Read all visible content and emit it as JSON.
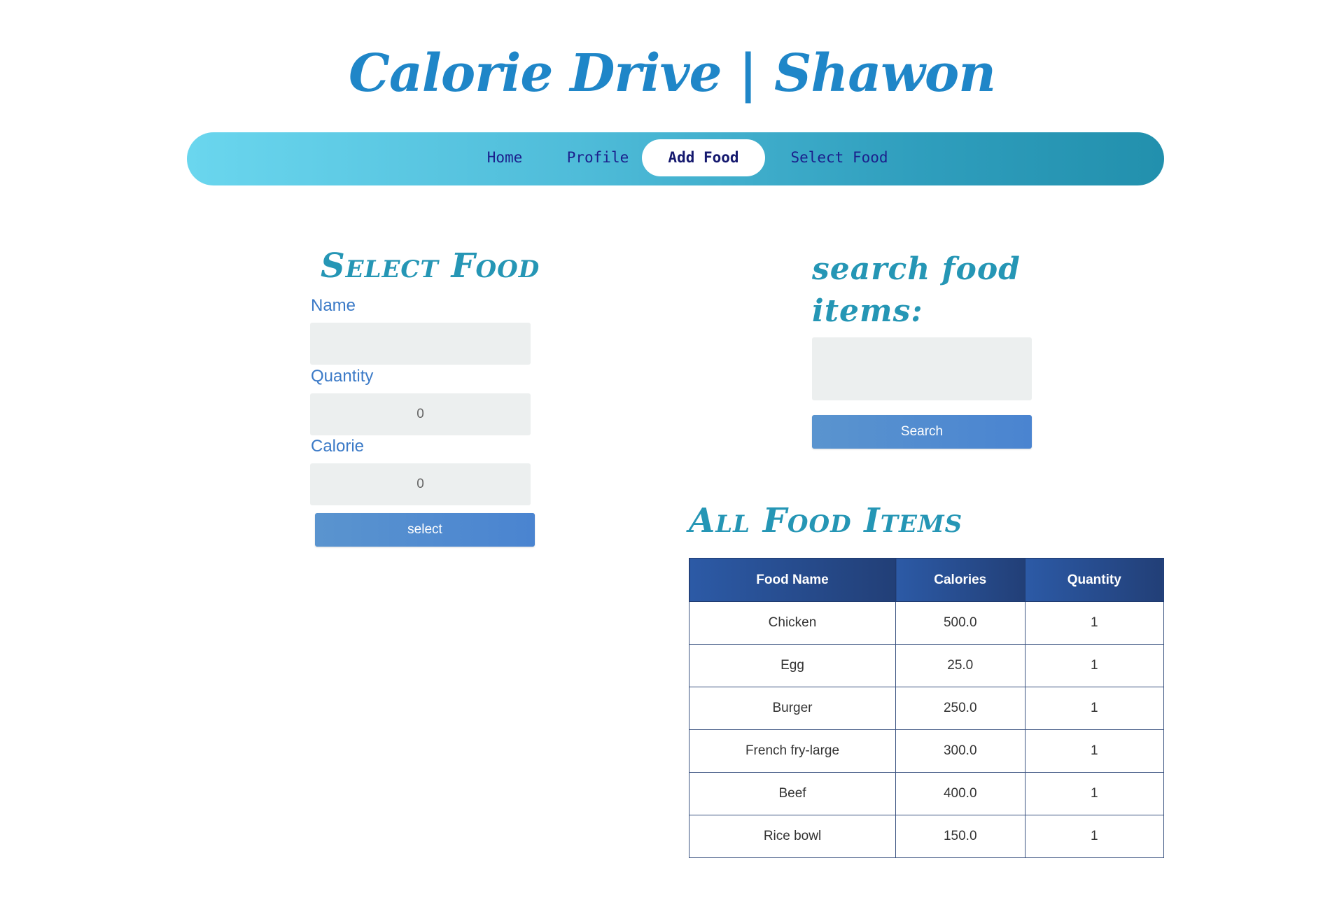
{
  "site": {
    "title": "Calorie Drive | Shawon"
  },
  "nav": {
    "items": [
      {
        "label": "Home",
        "active": false
      },
      {
        "label": "Profile",
        "active": false
      },
      {
        "label": "Add Food",
        "active": true
      },
      {
        "label": "Select Food",
        "active": false
      }
    ]
  },
  "select_food": {
    "heading": "Select Food",
    "name_label": "Name",
    "name_value": "",
    "quantity_label": "Quantity",
    "quantity_placeholder": "0",
    "calorie_label": "Calorie",
    "calorie_placeholder": "0",
    "select_button": "select"
  },
  "search": {
    "heading_line1": "search food",
    "heading_line2": "items:",
    "value": "",
    "button": "Search"
  },
  "all_food": {
    "heading": "All Food Items",
    "columns": [
      "Food Name",
      "Calories",
      "Quantity"
    ],
    "rows": [
      [
        "Chicken",
        "500.0",
        "1"
      ],
      [
        "Egg",
        "25.0",
        "1"
      ],
      [
        "Burger",
        "250.0",
        "1"
      ],
      [
        "French fry-large",
        "300.0",
        "1"
      ],
      [
        "Beef",
        "400.0",
        "1"
      ],
      [
        "Rice bowl",
        "150.0",
        "1"
      ]
    ]
  },
  "colors": {
    "title": "#1f86c8",
    "heading": "#2596b5",
    "label": "#3b7ac7",
    "nav_text": "#1b1f8c",
    "button": "#4a84d0",
    "table_header": "#223f77"
  }
}
